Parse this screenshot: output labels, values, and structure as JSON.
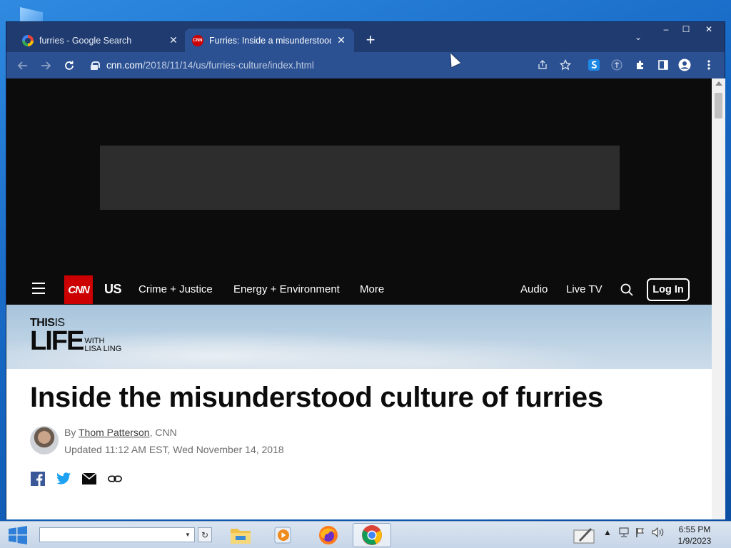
{
  "browser": {
    "tabs": [
      {
        "title": "furries - Google Search",
        "active": false,
        "favicon": "google-icon"
      },
      {
        "title": "Furries: Inside a misunderstood c",
        "active": true,
        "favicon": "cnn-icon"
      }
    ],
    "new_tab_symbol": "+",
    "tab_list_symbol": "⌄",
    "window_controls": {
      "minimize": "–",
      "maximize": "☐",
      "close": "✕"
    },
    "url": {
      "host": "cnn.com",
      "path": "/2018/11/14/us/furries-culture/index.html"
    }
  },
  "page": {
    "cnn_logo_text": "CNN",
    "nav": {
      "section": "US",
      "links": [
        "Crime + Justice",
        "Energy + Environment",
        "More"
      ],
      "right_links": [
        "Audio",
        "Live TV"
      ],
      "login": "Log In"
    },
    "show": {
      "line1_bold": "THIS",
      "line1_thin": "IS",
      "line2": "LIFE",
      "with1": "WITH",
      "with2": "LISA LING"
    },
    "headline": "Inside the misunderstood culture of furries",
    "byline_prefix": "By ",
    "author": "Thom Patterson",
    "byline_suffix": ", CNN",
    "updated": "Updated 11:12 AM EST, Wed November 14, 2018"
  },
  "taskbar": {
    "clock_time": "6:55 PM",
    "clock_date": "1/9/2023"
  },
  "colors": {
    "cnn_red": "#cc0000",
    "tab_active": "#2b5193",
    "tabstrip": "#1f3b70",
    "facebook": "#3b5998",
    "twitter": "#1da1f2"
  }
}
